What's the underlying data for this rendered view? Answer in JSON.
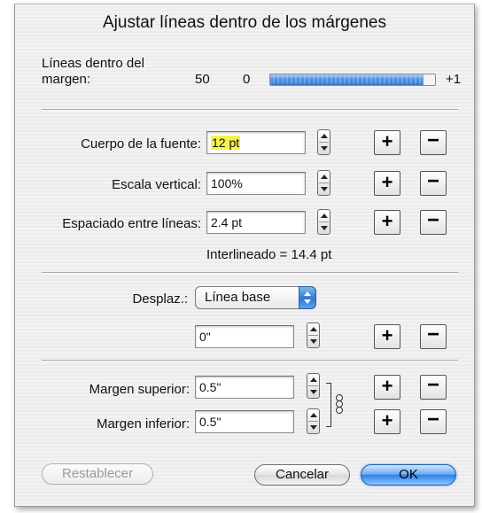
{
  "dialog": {
    "title": "Ajustar líneas dentro de los márgenes"
  },
  "lines_in_margin": {
    "label_line1": "Líneas dentro del",
    "label_line2": "margen:",
    "count": "50",
    "slider_min_value": "0",
    "slider_max_label": "+1",
    "slider_fill_percent": 93
  },
  "font_size": {
    "label": "Cuerpo de la fuente:",
    "value": "12 pt",
    "highlighted": true
  },
  "vertical_scale": {
    "label": "Escala vertical:",
    "value": "100%"
  },
  "line_spacing": {
    "label": "Espaciado entre líneas:",
    "value": "2.4 pt"
  },
  "leading_readout": "Interlineado = 14.4 pt",
  "offset": {
    "label": "Desplaz.:",
    "popup_value": "Línea base",
    "value": "0\""
  },
  "margins": {
    "top_label": "Margen superior:",
    "top_value": "0.5\"",
    "bottom_label": "Margen inferior:",
    "bottom_value": "0.5\""
  },
  "buttons": {
    "plus": "+",
    "minus": "−",
    "reset": "Restablecer",
    "cancel": "Cancelar",
    "ok": "OK"
  },
  "icons": {
    "stepper": "up-down-arrows",
    "popup_arrows": "popup-updown-arrows",
    "link": "chain-link"
  },
  "colors": {
    "highlight": "#f7f24a",
    "accent": "#2f82e6"
  }
}
